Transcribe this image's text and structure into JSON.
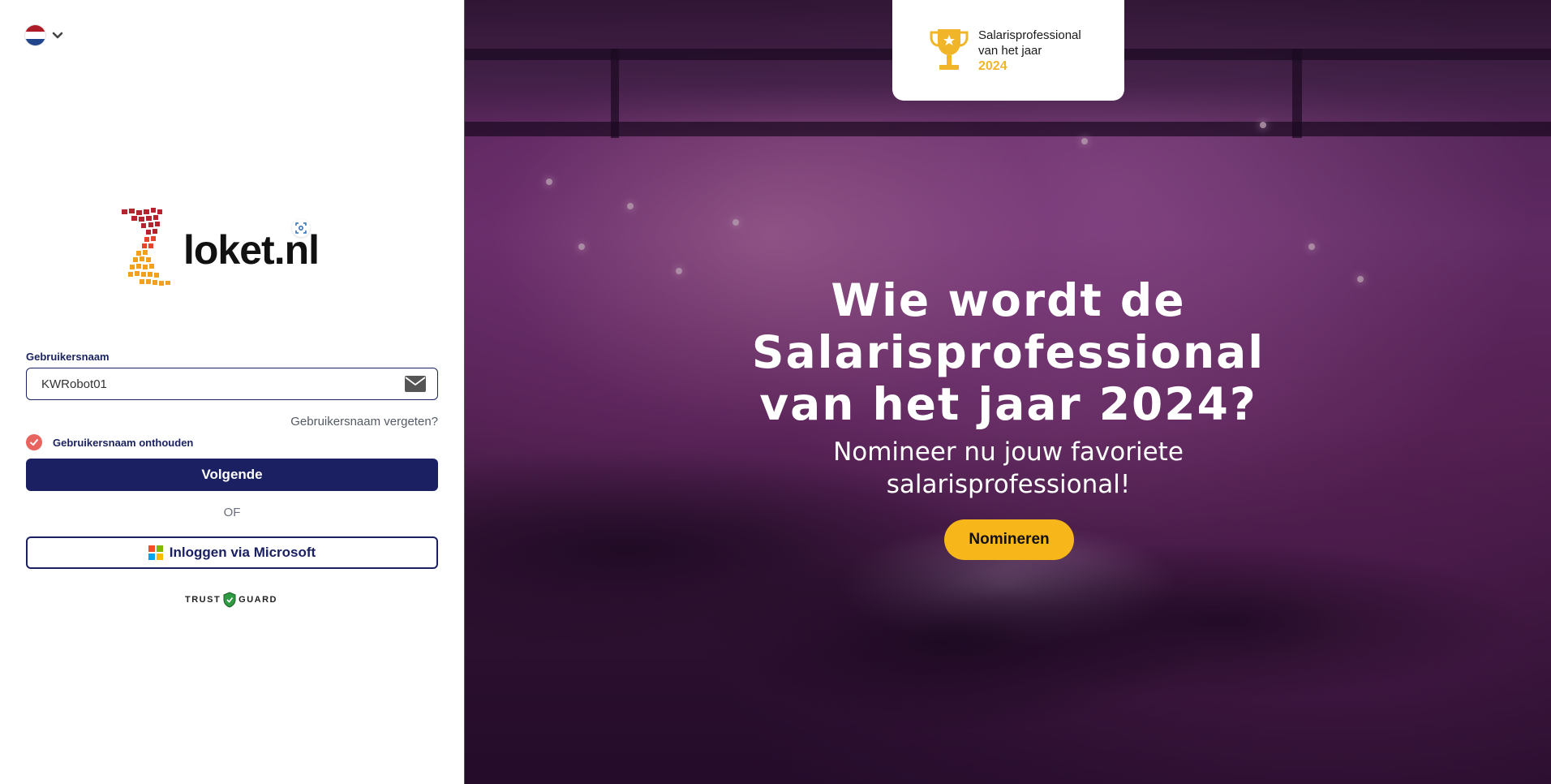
{
  "language": {
    "flag": "netherlands-flag",
    "colors": [
      "#ae1c28",
      "#ffffff",
      "#21468b"
    ]
  },
  "brand": {
    "name": "loket.nl"
  },
  "login": {
    "username_label": "Gebruikersnaam",
    "username_value": "KWRobot01",
    "forgot_link": "Gebruikersnaam vergeten?",
    "remember_label": "Gebruikersnaam onthouden",
    "remember_checked": true,
    "next_button": "Volgende",
    "or_divider": "OF",
    "microsoft_button": "Inloggen via Microsoft"
  },
  "trust_badge": {
    "left": "TRUST",
    "right": "GUARD"
  },
  "promo": {
    "award_line1": "Salarisprofessional",
    "award_line2": "van het jaar",
    "award_year": "2024",
    "headline_line1": "Wie wordt de",
    "headline_line2": "Salarisprofessional",
    "headline_line3": "van het jaar 2024?",
    "subline_line1": "Nomineer nu jouw favoriete",
    "subline_line2": "salarisprofessional!",
    "cta_button": "Nomineren"
  },
  "colors": {
    "primary": "#1b2063",
    "accent_yellow": "#f7b619",
    "checkbox": "#e8645f"
  }
}
